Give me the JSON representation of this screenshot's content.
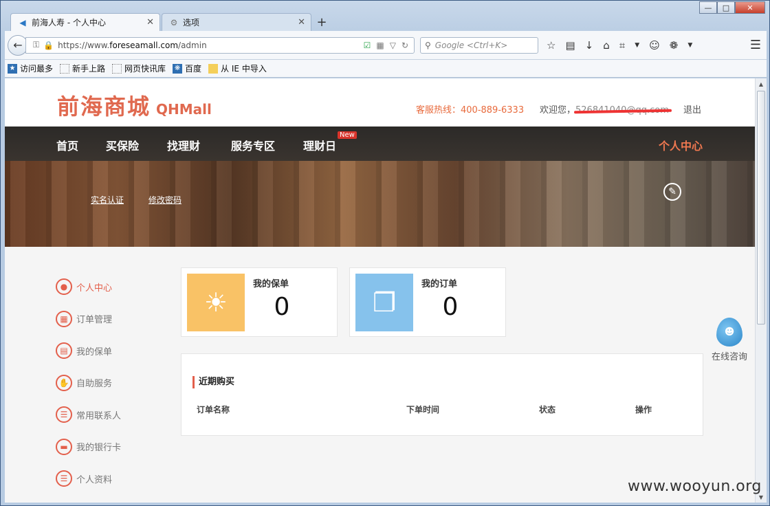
{
  "browser": {
    "tabs": [
      {
        "title": "前海人寿 - 个人中心",
        "active": true
      },
      {
        "title": "选项",
        "active": false
      }
    ],
    "url_prefix": "https://www.",
    "url_host": "foreseamall.com",
    "url_path": "/admin",
    "search_placeholder": "Google <Ctrl+K>",
    "bookmarks": [
      "访问最多",
      "新手上路",
      "网页快讯库",
      "百度",
      "从 IE 中导入"
    ]
  },
  "site": {
    "logo_cn": "前海商城",
    "logo_en": "QHMall",
    "hotline": "客服热线：400-889-6333",
    "welcome_prefix": "欢迎您，",
    "welcome_email": "526841040@qq.com",
    "logout": "退出"
  },
  "nav": {
    "items": [
      "首页",
      "买保险",
      "找理财",
      "服务专区",
      "理财日"
    ],
    "new_badge": "New",
    "account": "个人中心"
  },
  "banner": {
    "links": [
      "实名认证",
      "修改密码"
    ]
  },
  "sidebar": {
    "items": [
      "个人中心",
      "订单管理",
      "我的保单",
      "自助服务",
      "常用联系人",
      "我的银行卡",
      "个人资料"
    ]
  },
  "cards": [
    {
      "title": "我的保单",
      "count": "0",
      "color": "#f9c266"
    },
    {
      "title": "我的订单",
      "count": "0",
      "color": "#86c2ec"
    }
  ],
  "recent": {
    "title": "近期购买",
    "headers": [
      "订单名称",
      "下单时间",
      "状态",
      "操作"
    ]
  },
  "consult": {
    "label": "在线咨询"
  },
  "watermark": "www.wooyun.org",
  "colors": {
    "accent": "#e35f4b",
    "nav_bg": "#2c2a28"
  }
}
